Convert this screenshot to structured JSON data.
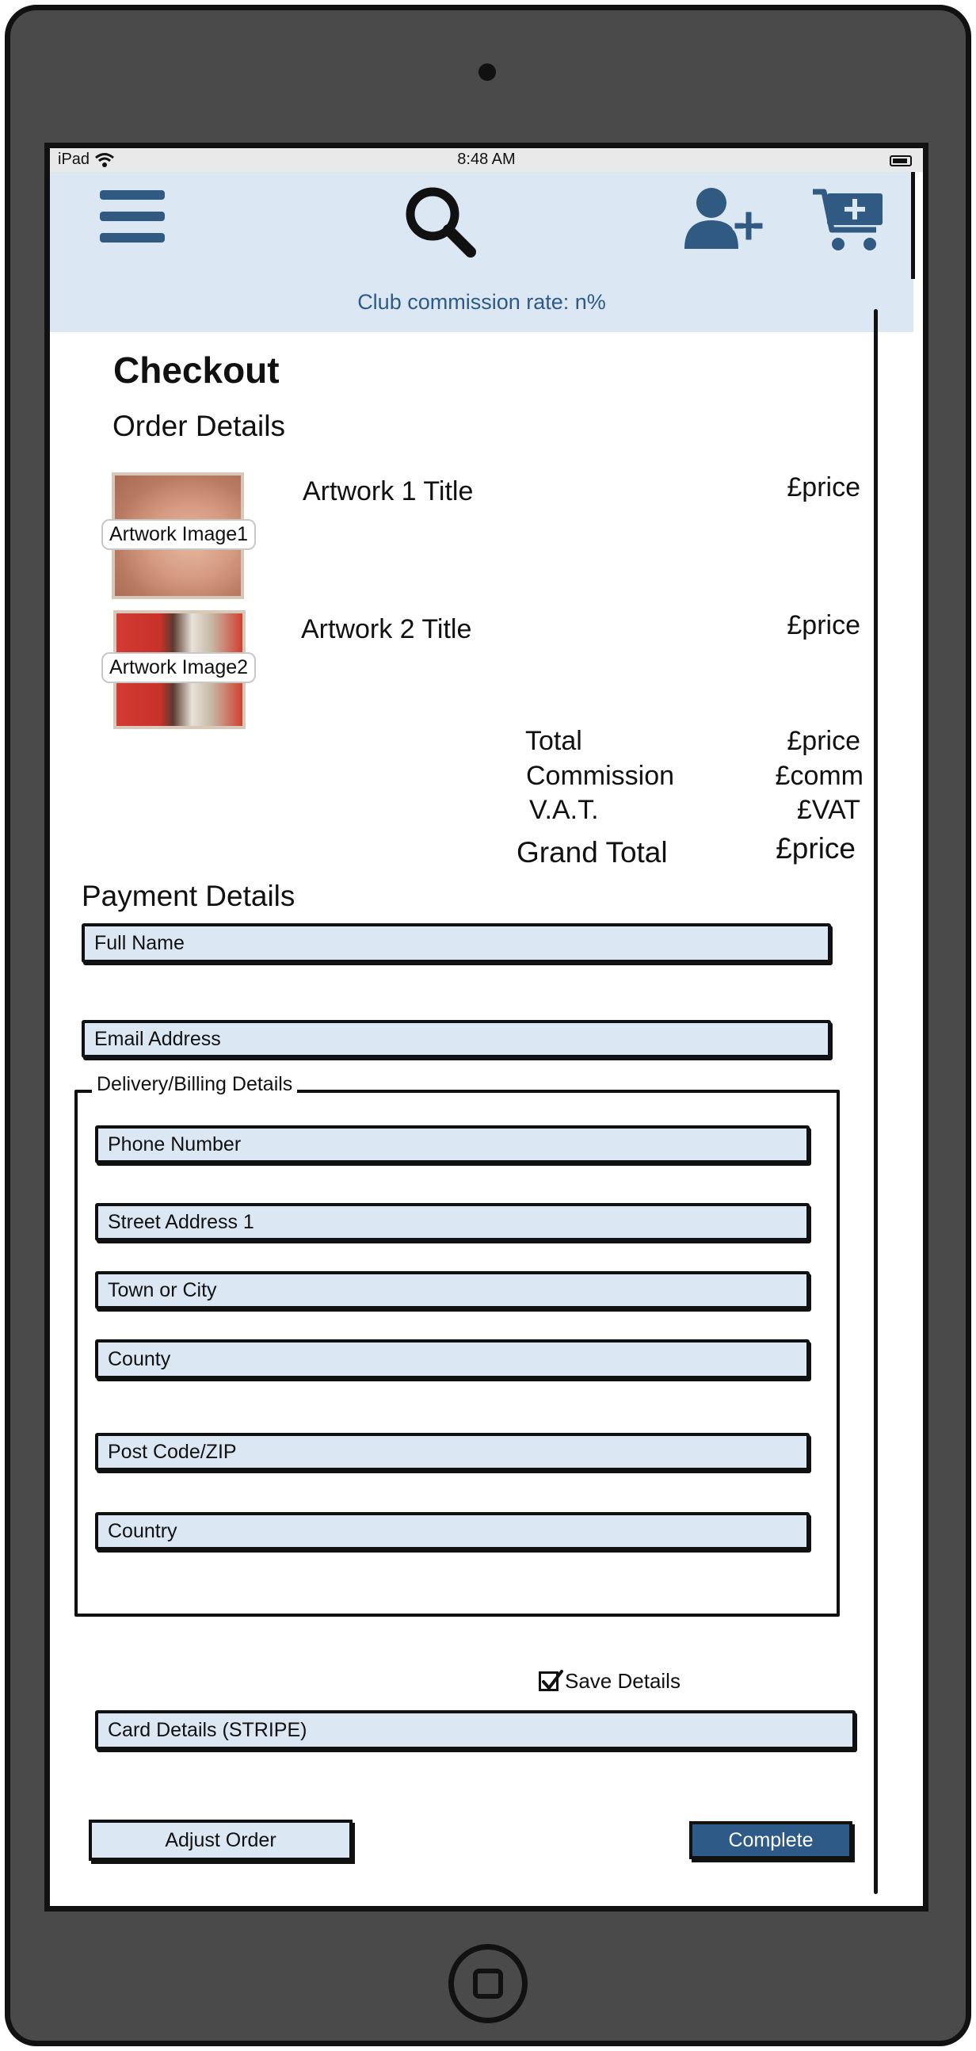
{
  "status_bar": {
    "carrier": "iPad",
    "time": "8:48 AM"
  },
  "nav": {
    "menu_icon": "hamburger-menu-icon",
    "search_icon": "search-icon",
    "add_user_icon": "add-user-icon",
    "cart_icon": "add-to-cart-icon",
    "commission_text": "Club commission rate: n%"
  },
  "colors": {
    "accent": "#2d5a86",
    "field_bg": "#dce7f4",
    "frame": "#4a4a4a"
  },
  "checkout": {
    "title": "Checkout",
    "order_heading": "Order Details",
    "items": [
      {
        "image_label": "Artwork Image1",
        "title": "Artwork 1 Title",
        "price": "£price"
      },
      {
        "image_label": "Artwork Image2",
        "title": "Artwork 2 Title",
        "price": "£price"
      }
    ],
    "totals": {
      "total_label": "Total",
      "total_value": "£price",
      "commission_label": "Commission",
      "commission_value": "£comm",
      "vat_label": "V.A.T.",
      "vat_value": "£VAT",
      "grand_label": "Grand Total",
      "grand_value": "£price"
    }
  },
  "payment": {
    "heading": "Payment Details",
    "full_name": "Full Name",
    "email": "Email Address",
    "delivery_legend": "Delivery/Billing Details",
    "phone": "Phone Number",
    "street": "Street Address 1",
    "town": "Town or City",
    "county": "County",
    "postcode": "Post Code/ZIP",
    "country": "Country",
    "save_details": "Save Details",
    "save_checked": true,
    "card_details": "Card Details (STRIPE)",
    "adjust_button": "Adjust Order",
    "complete_button": "Complete"
  }
}
